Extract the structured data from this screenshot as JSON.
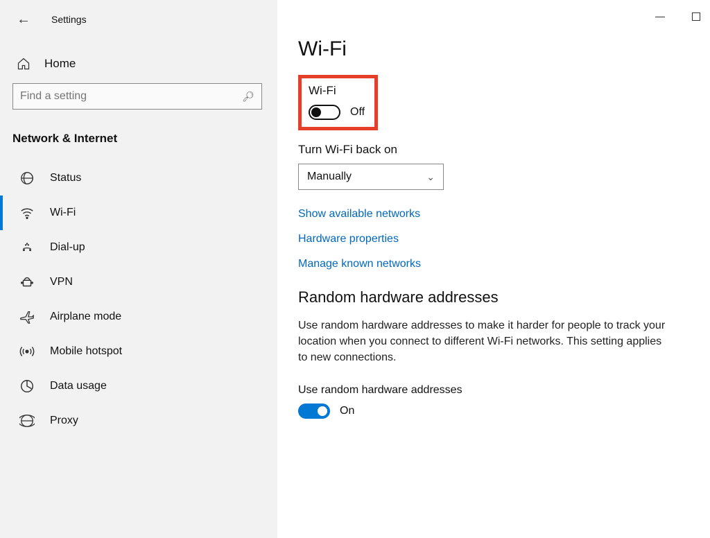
{
  "header": {
    "title": "Settings"
  },
  "sidebar": {
    "home_label": "Home",
    "search_placeholder": "Find a setting",
    "category_title": "Network & Internet",
    "items": [
      {
        "label": "Status",
        "icon": "status-icon"
      },
      {
        "label": "Wi-Fi",
        "icon": "wifi-icon"
      },
      {
        "label": "Dial-up",
        "icon": "dialup-icon"
      },
      {
        "label": "VPN",
        "icon": "vpn-icon"
      },
      {
        "label": "Airplane mode",
        "icon": "airplane-icon"
      },
      {
        "label": "Mobile hotspot",
        "icon": "hotspot-icon"
      },
      {
        "label": "Data usage",
        "icon": "datausage-icon"
      },
      {
        "label": "Proxy",
        "icon": "proxy-icon"
      }
    ]
  },
  "main": {
    "page_title": "Wi-Fi",
    "wifi_toggle": {
      "label": "Wi-Fi",
      "state_text": "Off"
    },
    "turn_back_on": {
      "label": "Turn Wi-Fi back on",
      "selected": "Manually"
    },
    "links": {
      "show_networks": "Show available networks",
      "hardware_props": "Hardware properties",
      "manage_known": "Manage known networks"
    },
    "random_mac": {
      "heading": "Random hardware addresses",
      "description": "Use random hardware addresses to make it harder for people to track your location when you connect to different Wi-Fi networks. This setting applies to new connections.",
      "toggle_label": "Use random hardware addresses",
      "state_text": "On"
    }
  }
}
